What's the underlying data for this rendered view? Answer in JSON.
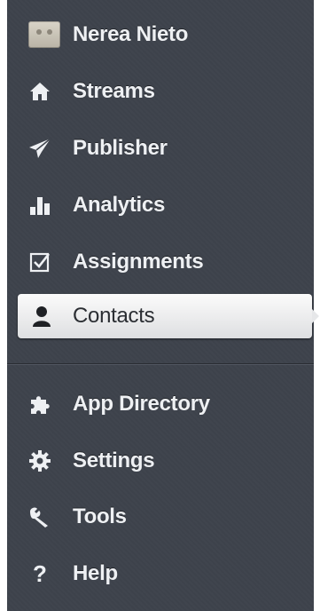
{
  "profile": {
    "name": "Nerea Nieto",
    "icon": "avatar"
  },
  "nav_primary": [
    {
      "label": "Streams",
      "icon": "home-icon"
    },
    {
      "label": "Publisher",
      "icon": "paper-plane-icon"
    },
    {
      "label": "Analytics",
      "icon": "bar-chart-icon"
    },
    {
      "label": "Assignments",
      "icon": "checkbox-icon"
    },
    {
      "label": "Contacts",
      "icon": "person-icon",
      "active": true
    }
  ],
  "nav_secondary": [
    {
      "label": "App Directory",
      "icon": "puzzle-icon"
    },
    {
      "label": "Settings",
      "icon": "gear-icon"
    },
    {
      "label": "Tools",
      "icon": "wrench-icon"
    },
    {
      "label": "Help",
      "icon": "question-icon"
    }
  ],
  "colors": {
    "sidebar_bg": "#3e434c",
    "text_light": "#eef0f3",
    "active_bg": "#f0f0f1",
    "active_text": "#2b2e33"
  }
}
